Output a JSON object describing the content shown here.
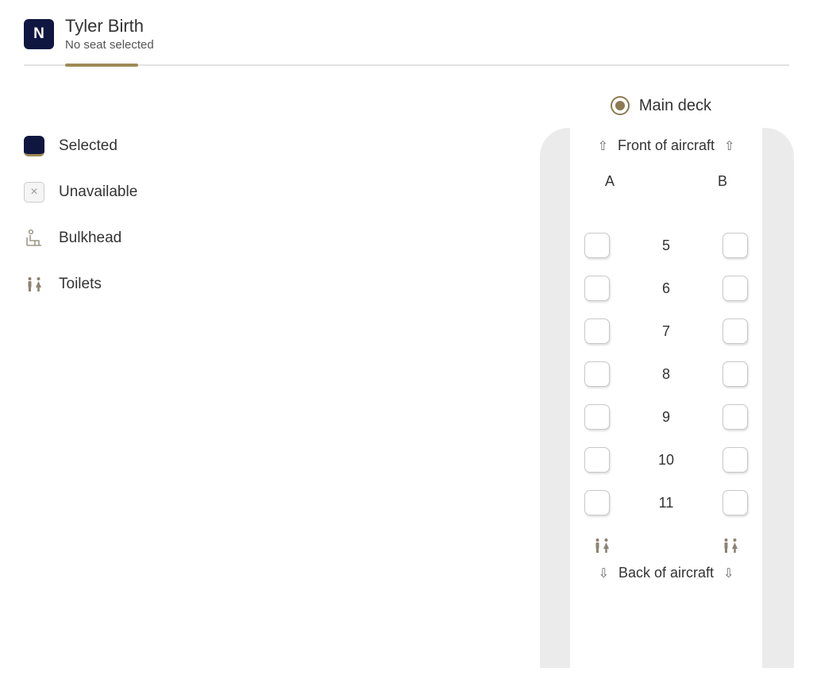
{
  "passenger": {
    "avatar_letter": "N",
    "name": "Tyler Birth",
    "subtitle": "No seat selected"
  },
  "legend": {
    "selected": "Selected",
    "unavailable": "Unavailable",
    "bulkhead": "Bulkhead",
    "toilets": "Toilets",
    "unavailable_glyph": "×"
  },
  "deck": {
    "label": "Main deck"
  },
  "seatmap": {
    "front_label": "Front of aircraft",
    "back_label": "Back of aircraft",
    "columns": {
      "a": "A",
      "b": "B"
    },
    "rows": [
      {
        "num": "5"
      },
      {
        "num": "6"
      },
      {
        "num": "7"
      },
      {
        "num": "8"
      },
      {
        "num": "9"
      },
      {
        "num": "10"
      },
      {
        "num": "11"
      }
    ],
    "arrows": {
      "up": "⇧",
      "down": "⇩"
    }
  }
}
